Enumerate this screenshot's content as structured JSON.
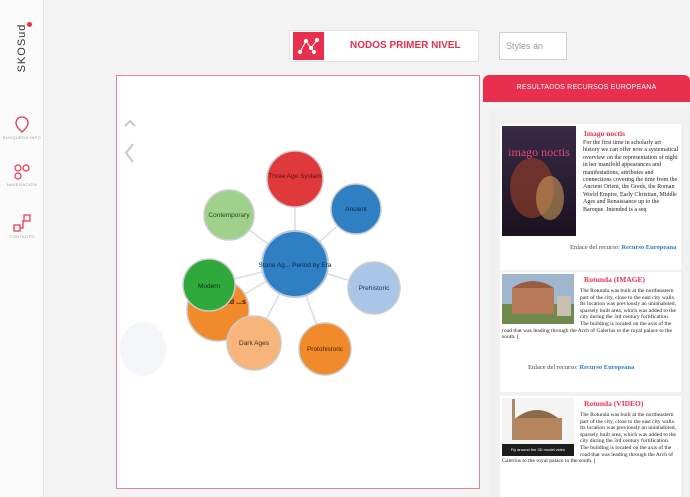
{
  "app": {
    "brand": "SKOSud",
    "colors": {
      "accent": "#e8304e",
      "link": "#2a7fc9",
      "muted": "#999999"
    }
  },
  "sidebar": {
    "items": [
      {
        "label": "BÚSQUEDA INFO",
        "icon": "map-pin-icon"
      },
      {
        "label": "NAVEGACIÓN",
        "icon": "navigation-icon"
      },
      {
        "label": "CONTACTO",
        "icon": "share-nodes-icon"
      }
    ]
  },
  "header": {
    "title": "NODOS PRIMER NIVEL",
    "icon": "node-graph-icon",
    "styles_placeholder": "Styles an"
  },
  "graph": {
    "center": {
      "label": "Stone Ag... Period by Era",
      "color": "#2f7fc3"
    },
    "nodes": [
      {
        "label": "Three Age System",
        "color": "#e0393b"
      },
      {
        "label": "Ancient",
        "color": "#2f7fc3"
      },
      {
        "label": "Prehistoric",
        "color": "#a9c6e8"
      },
      {
        "label": "Protohistoric",
        "color": "#f08a2a"
      },
      {
        "label": "Dark Ages",
        "color": "#f7b57c"
      },
      {
        "label": "Contemporary",
        "color": "#9fd18a"
      },
      {
        "label": "Modern",
        "color": "#2fa83c"
      },
      {
        "label": "...d ...s",
        "color": "#f08a2a"
      }
    ]
  },
  "results": {
    "title": "RESULTADOS RECURSOS EUROPEANA",
    "link_prefix": "Enlace del recurso:",
    "cards": [
      {
        "title": "Imago noctis",
        "thumb_icon": "book-cover-image",
        "description": "For the first time in scholarly art history we can offer now a systematical overview on the representation of night in her manifold appearances and manifestations, attributes and connections covering the time from the Ancient Orient, the Greek, the Roman World Empire, Early Christian, Middle Ages and Renaissance up to the Baroque. Intended is a seq",
        "link_text": "Recurso Europeana",
        "cover_title": "imago noctis"
      },
      {
        "title": "Rotunda (IMAGE)",
        "thumb_icon": "rotunda-photo-image",
        "description": "The Rotunda was built at the northeastern part of the city, close to the east city walls. Its location was previously an uninhabited, sparsely built area, which was added to the city during the 3rd century fortification. The building is located on the axis of the road that was leading through the Arch of Galerius to the royal palace to the south. [",
        "link_text": "Recurso Europeana"
      },
      {
        "title": "Rotunda (VIDEO)",
        "thumb_icon": "rotunda-3d-model-image",
        "thumb_caption": "Fly around the 3D model video",
        "description": "The Rotunda was built at the northeastern part of the city, close to the east city walls. Its location was previously an uninhabited, sparsely built area, which was added to the city during the 3rd century fortification. The building is located on the axis of the road that was leading through the Arch of Galerius to the royal palace to the south. ["
      }
    ]
  }
}
